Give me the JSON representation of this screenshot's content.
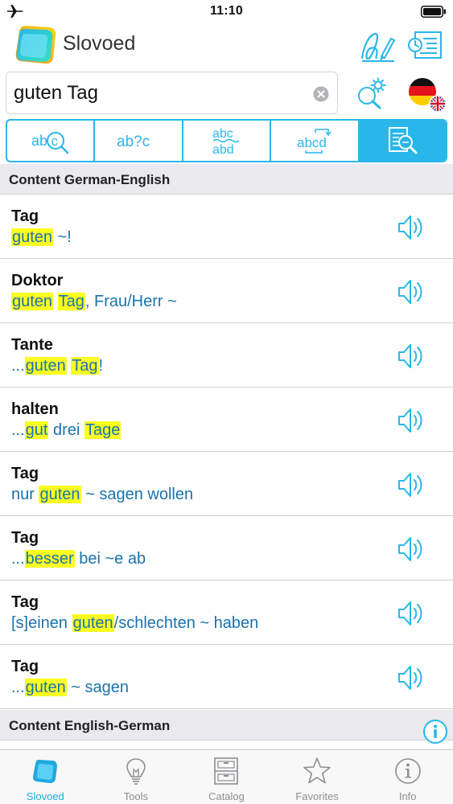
{
  "status_bar": {
    "time": "11:10"
  },
  "app": {
    "title": "Slovoed",
    "accent_color": "#29b7e9",
    "highlight_color": "#fbff1f",
    "link_color": "#1a73ad"
  },
  "search": {
    "query": "guten Tag"
  },
  "icons": {
    "handwriting": "handwriting-icon",
    "history": "history-icon",
    "search_settings": "search-settings-icon",
    "flags": [
      "german-flag-icon",
      "uk-flag-icon"
    ]
  },
  "mode_tabs": [
    {
      "name": "spelling-search",
      "icon": "abc-magnifier-icon"
    },
    {
      "name": "wildcard-search",
      "icon": "ab-question-c-icon"
    },
    {
      "name": "fuzzy-search",
      "icon": "abc-abd-icon"
    },
    {
      "name": "anagram-search",
      "icon": "abc-swap-icon"
    },
    {
      "name": "full-text-search",
      "icon": "document-magnifier-icon",
      "active": true
    }
  ],
  "sections": [
    {
      "title": "Content German-English",
      "results": [
        {
          "headword": "Tag",
          "phrase": [
            {
              "t": "guten",
              "h": true
            },
            {
              "t": " ~!",
              "h": false
            }
          ]
        },
        {
          "headword": "Doktor",
          "phrase": [
            {
              "t": "guten",
              "h": true
            },
            {
              "t": " ",
              "h": false
            },
            {
              "t": "Tag",
              "h": true
            },
            {
              "t": ", Frau/Herr ~",
              "h": false
            }
          ]
        },
        {
          "headword": "Tante",
          "phrase": [
            {
              "t": "...",
              "h": false
            },
            {
              "t": "guten",
              "h": true
            },
            {
              "t": " ",
              "h": false
            },
            {
              "t": "Tag",
              "h": true
            },
            {
              "t": "!",
              "h": false
            }
          ]
        },
        {
          "headword": "halten",
          "phrase": [
            {
              "t": "...",
              "h": false
            },
            {
              "t": "gut",
              "h": true
            },
            {
              "t": " drei ",
              "h": false
            },
            {
              "t": "Tage",
              "h": true
            }
          ]
        },
        {
          "headword": "Tag",
          "phrase": [
            {
              "t": "nur ",
              "h": false
            },
            {
              "t": "guten",
              "h": true
            },
            {
              "t": " ~ sagen wollen",
              "h": false
            }
          ]
        },
        {
          "headword": "Tag",
          "phrase": [
            {
              "t": "...",
              "h": false
            },
            {
              "t": "besser",
              "h": true
            },
            {
              "t": " bei ~e ab",
              "h": false
            }
          ]
        },
        {
          "headword": "Tag",
          "phrase": [
            {
              "t": "[s]einen ",
              "h": false
            },
            {
              "t": "guten",
              "h": true
            },
            {
              "t": "/schlechten ~ haben",
              "h": false
            }
          ]
        },
        {
          "headword": "Tag",
          "phrase": [
            {
              "t": "...",
              "h": false
            },
            {
              "t": "guten",
              "h": true
            },
            {
              "t": " ~ sagen",
              "h": false
            }
          ]
        }
      ]
    },
    {
      "title": "Content English-German",
      "results": []
    }
  ],
  "tab_bar": [
    {
      "label": "Slovoed",
      "icon": "slovoed-logo-icon",
      "active": true
    },
    {
      "label": "Tools",
      "icon": "lightbulb-icon",
      "active": false
    },
    {
      "label": "Catalog",
      "icon": "cabinet-icon",
      "active": false
    },
    {
      "label": "Favorites",
      "icon": "star-icon",
      "active": false
    },
    {
      "label": "Info",
      "icon": "info-icon",
      "active": false
    }
  ]
}
